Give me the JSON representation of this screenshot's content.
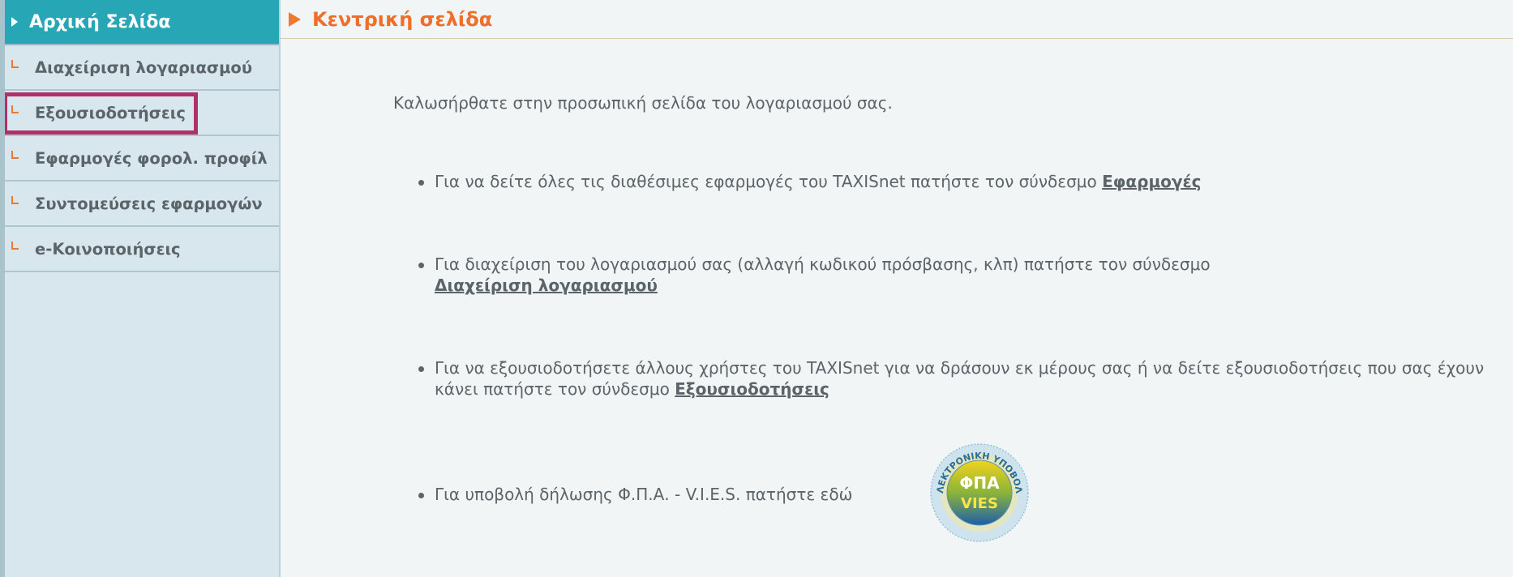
{
  "sidebar": {
    "home": "Αρχική Σελίδα",
    "items": [
      {
        "label": "Διαχείριση λογαριασμού"
      },
      {
        "label": "Εξουσιοδοτήσεις"
      },
      {
        "label": "Εφαρμογές φορολ. προφίλ"
      },
      {
        "label": "Συντομεύσεις εφαρμογών"
      },
      {
        "label": "e-Κοινοποιήσεις"
      }
    ]
  },
  "main": {
    "title": "Κεντρική σελίδα",
    "welcome": "Καλωσήρθατε στην προσωπική σελίδα του λογαριασμού σας.",
    "bullets": [
      {
        "text": "Για να δείτε όλες τις διαθέσιμες εφαρμογές του TAXISnet πατήστε τον σύνδεσμο ",
        "link": "Εφαρμογές"
      },
      {
        "text": "Για διαχείριση του λογαριασμού σας (αλλαγή κωδικού πρόσβασης, κλπ) πατήστε τον σύνδεσμο ",
        "link": "Διαχείριση λογαριασμού"
      },
      {
        "text": "Για να εξουσιοδοτήσετε άλλους χρήστες του TAXISnet για να δράσουν εκ μέρους σας ή να δείτε εξουσιοδοτήσεις που σας έχουν κάνει πατήστε τον σύνδεσμο ",
        "link": "Εξουσιοδοτήσεις"
      },
      {
        "text": "Για υποβολή δήλωσης Φ.Π.Α. - V.I.E.S. πατήστε εδώ"
      }
    ],
    "vies_badge": {
      "top": "ΦΠΑ",
      "bottom": "VIES",
      "ring_text": "ΗΛΕΚΤΡΟΝΙΚΗ ΥΠΟΒΟΛΗ"
    }
  },
  "colors": {
    "accent_orange": "#ef6f2a",
    "home_teal": "#27a6b6",
    "highlight": "#b0306a"
  }
}
